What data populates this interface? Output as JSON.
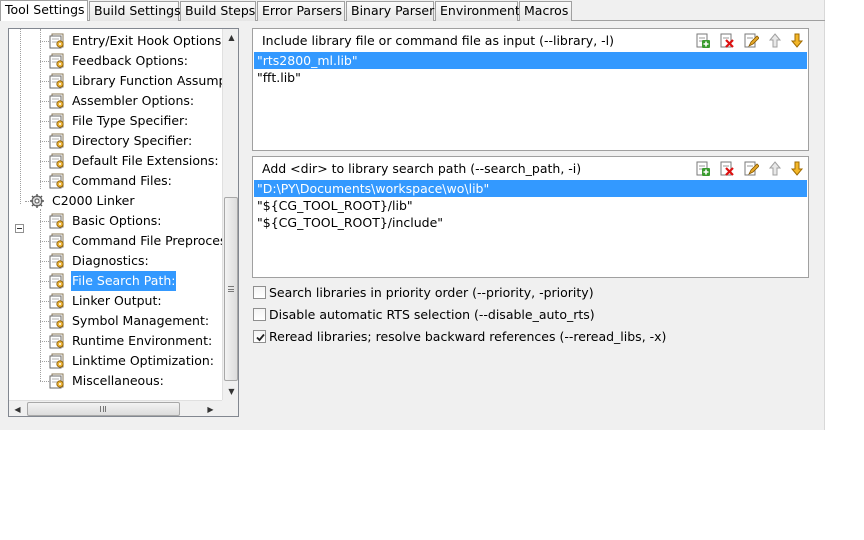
{
  "tabs": [
    {
      "label": "Tool Settings",
      "active": true
    },
    {
      "label": "Build Settings",
      "active": false
    },
    {
      "label": "Build Steps",
      "active": false
    },
    {
      "label": "Error Parsers",
      "active": false
    },
    {
      "label": "Binary Parser",
      "active": false
    },
    {
      "label": "Environment",
      "active": false
    },
    {
      "label": "Macros",
      "active": false
    }
  ],
  "tree": {
    "items": [
      {
        "label": "Entry/Exit Hook Options:",
        "icon": "option-page-icon"
      },
      {
        "label": "Feedback Options:",
        "icon": "option-page-icon"
      },
      {
        "label": "Library Function Assumpti",
        "icon": "option-page-icon"
      },
      {
        "label": "Assembler Options:",
        "icon": "option-page-icon"
      },
      {
        "label": "File Type Specifier:",
        "icon": "option-page-icon"
      },
      {
        "label": "Directory Specifier:",
        "icon": "option-page-icon"
      },
      {
        "label": "Default File Extensions:",
        "icon": "option-page-icon"
      },
      {
        "label": "Command Files:",
        "icon": "option-page-icon"
      },
      {
        "label": "C2000 Linker",
        "icon": "tool-gear-icon",
        "expanded": true
      },
      {
        "label": "Basic Options:",
        "icon": "option-page-icon"
      },
      {
        "label": "Command File Preprocess",
        "icon": "option-page-icon"
      },
      {
        "label": "Diagnostics:",
        "icon": "option-page-icon"
      },
      {
        "label": "File Search Path:",
        "icon": "option-page-icon",
        "selected": true
      },
      {
        "label": "Linker Output:",
        "icon": "option-page-icon"
      },
      {
        "label": "Symbol Management:",
        "icon": "option-page-icon"
      },
      {
        "label": "Runtime Environment:",
        "icon": "option-page-icon"
      },
      {
        "label": "Linktime Optimization:",
        "icon": "option-page-icon"
      },
      {
        "label": "Miscellaneous:",
        "icon": "option-page-icon"
      }
    ]
  },
  "library_panel": {
    "title": "Include library file or command file as input (--library, -l)",
    "items": [
      {
        "value": "\"rts2800_ml.lib\"",
        "selected": true
      },
      {
        "value": "\"fft.lib\"",
        "selected": false
      }
    ]
  },
  "search_path_panel": {
    "title": "Add <dir> to library search path (--search_path, -i)",
    "items": [
      {
        "value": "\"D:\\PY\\Documents\\workspace\\wo\\lib\"",
        "selected": true
      },
      {
        "value": "\"${CG_TOOL_ROOT}/lib\"",
        "selected": false
      },
      {
        "value": "\"${CG_TOOL_ROOT}/include\"",
        "selected": false
      }
    ]
  },
  "panel_tools": [
    "add-icon",
    "delete-icon",
    "edit-icon",
    "move-up-icon",
    "move-down-icon"
  ],
  "options": [
    {
      "label": "Search libraries in priority order (--priority, -priority)",
      "checked": false
    },
    {
      "label": "Disable automatic RTS selection (--disable_auto_rts)",
      "checked": false
    },
    {
      "label": "Reread libraries; resolve backward references (--reread_libs, -x)",
      "checked": true
    }
  ],
  "colors": {
    "selection": "#3399ff",
    "frame": "#f0f0f0"
  }
}
